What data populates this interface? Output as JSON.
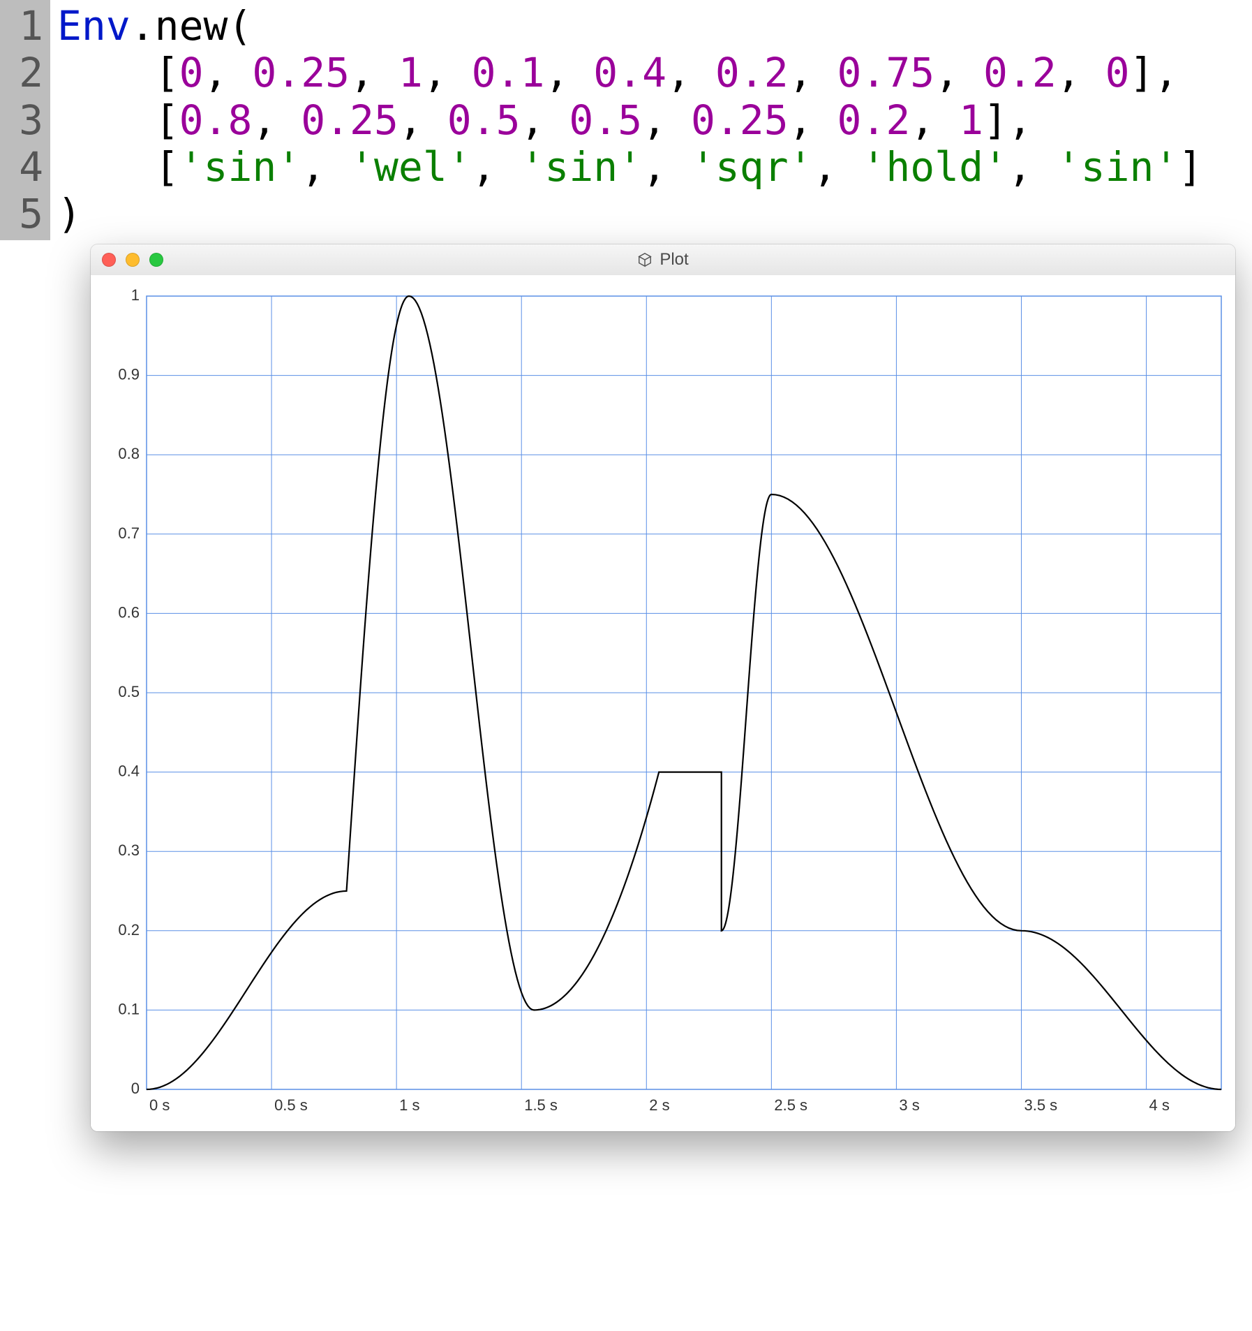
{
  "editor": {
    "line_numbers": [
      "1",
      "2",
      "3",
      "4",
      "5"
    ],
    "tokens": {
      "class": "Env",
      "method": ".new"
    },
    "levels": [
      0,
      0.25,
      1.0,
      0.1,
      0.4,
      0.2,
      0.75,
      0.2,
      0
    ],
    "times": [
      0.8,
      0.25,
      0.5,
      0.5,
      0.25,
      0.2,
      1.0
    ],
    "curves": [
      "sin",
      "wel",
      "sin",
      "sqr",
      "hold",
      "sin"
    ]
  },
  "window": {
    "title": "Plot"
  },
  "chart_data": {
    "type": "line",
    "title": "",
    "xlabel": "",
    "ylabel": "",
    "xlim": [
      0,
      4.3
    ],
    "ylim": [
      0,
      1.0
    ],
    "x_ticks": [
      0,
      0.5,
      1,
      1.5,
      2,
      2.5,
      3,
      3.5,
      4
    ],
    "x_tick_labels": [
      "0 s",
      "0.5 s",
      "1 s",
      "1.5 s",
      "2 s",
      "2.5 s",
      "3 s",
      "3.5 s",
      "4 s"
    ],
    "y_ticks": [
      0,
      0.1,
      0.2,
      0.3,
      0.4,
      0.5,
      0.6,
      0.7,
      0.8,
      0.9,
      1
    ],
    "y_tick_labels": [
      "0",
      "0.1",
      "0.2",
      "0.3",
      "0.4",
      "0.5",
      "0.6",
      "0.7",
      "0.8",
      "0.9",
      "1"
    ],
    "envelope": {
      "levels": [
        0,
        0.25,
        1.0,
        0.1,
        0.4,
        0.2,
        0.75,
        0.2,
        0
      ],
      "times": [
        0.8,
        0.25,
        0.5,
        0.5,
        0.25,
        0.2,
        1.0,
        0.8
      ],
      "curves": [
        "sin",
        "wel",
        "sin",
        "sqr",
        "hold",
        "sin",
        "sin",
        "sin"
      ]
    },
    "breakpoints_x": [
      0,
      0.8,
      1.05,
      1.55,
      2.05,
      2.3,
      2.5,
      3.5,
      4.3
    ],
    "breakpoints_y": [
      0,
      0.25,
      1.0,
      0.1,
      0.4,
      0.2,
      0.75,
      0.2,
      0
    ]
  }
}
